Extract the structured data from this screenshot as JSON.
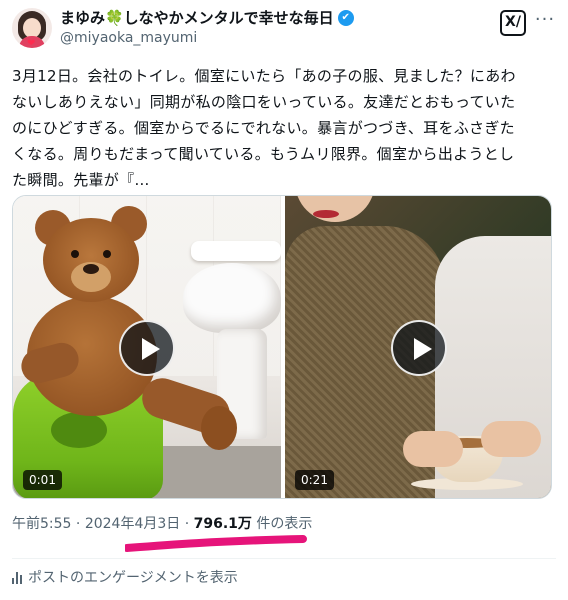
{
  "author": {
    "display_name": "まゆみ🍀しなやかメンタルで幸せな毎日",
    "handle": "@miyaoka_mayumi",
    "verified_icon": "✔"
  },
  "header_icons": {
    "grok": "grok-icon",
    "grok_glyph": "X/",
    "more": "more-icon",
    "more_glyph": "···"
  },
  "tweet": {
    "lines": [
      "3月12日。会社のトイレ。個室にいたら「あの子の服、見ました？にあわ",
      "ないしありえない」同期が私の陰口をいっている。友達だとおもっていた",
      "のにひどすぎる。個室からでるにでれない。暴言がつづき、耳をふさぎた",
      "くなる。周りもだまって聞いている。もうムリ限界。個室から出ようとし",
      "た瞬間。先輩が『…"
    ]
  },
  "media": {
    "videos": [
      {
        "duration": "0:01",
        "play_icon": "play-icon"
      },
      {
        "duration": "0:21",
        "play_icon": "play-icon"
      }
    ]
  },
  "meta": {
    "time": "午前5:55",
    "separator1": " · ",
    "date": "2024年4月3日",
    "separator2": " · ",
    "views_count": "796.1万",
    "views_label": " 件の表示"
  },
  "engagement": {
    "icon": "analytics-bars-icon",
    "label": "ポストのエンゲージメントを表示"
  },
  "colors": {
    "text": "#0f1419",
    "secondary": "#536471",
    "verified": "#1d9bf0",
    "highlight_marker": "#e6147a"
  }
}
